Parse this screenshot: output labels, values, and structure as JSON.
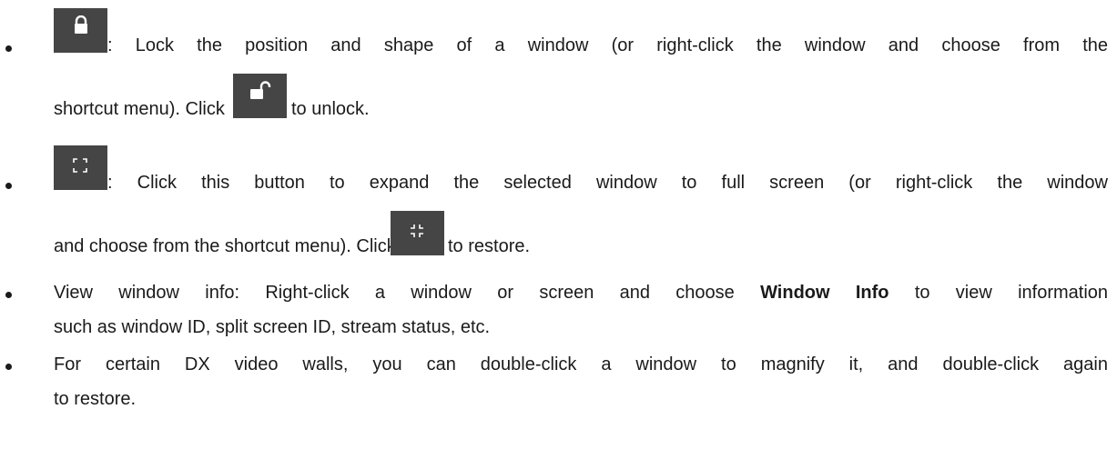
{
  "items": [
    {
      "lock_text_1": ": Lock the position and shape of a window (or right-click the window and choose from the",
      "lock_text_2_a": "shortcut menu). Click",
      "lock_text_2_b": "to unlock.",
      "icon_lock": "lock-icon",
      "icon_unlock": "unlock-icon"
    },
    {
      "fs_text_1": ": Click this button to expand the selected window to full screen (or right-click the window",
      "fs_text_2_a": "and choose from the shortcut menu). Click",
      "fs_text_2_b": "to restore.",
      "icon_expand": "fullscreen-expand-icon",
      "icon_restore": "fullscreen-restore-icon"
    },
    {
      "info_text_1_a": "View window info: Right-click a window or screen and choose",
      "info_text_1_bold": "Window Info",
      "info_text_1_b": "to view information",
      "info_text_2": "such as window ID, split screen ID, stream status, etc."
    },
    {
      "dx_text_1": "For certain DX video walls, you can double-click a window to magnify it, and double-click again",
      "dx_text_2": "to restore."
    }
  ]
}
